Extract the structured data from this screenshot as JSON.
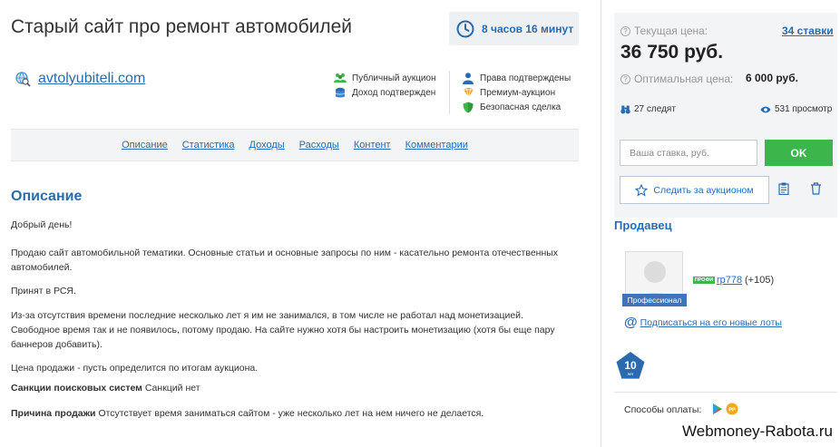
{
  "header": {
    "title": "Старый сайт про ремонт автомобилей",
    "timer": "8 часов 16 минут"
  },
  "site": {
    "link": "avtolyubiteli.com"
  },
  "badges_left": [
    {
      "icon": "users-icon",
      "label": "Публичный аукцион"
    },
    {
      "icon": "coins-icon",
      "label": "Доход подтвержден"
    }
  ],
  "badges_right": [
    {
      "icon": "person-icon",
      "label": "Права подтверждены"
    },
    {
      "icon": "premium-icon",
      "label": "Премиум-аукцион"
    },
    {
      "icon": "shield-icon",
      "label": "Безопасная сделка"
    }
  ],
  "tabs": [
    "Описание",
    "Статистика",
    "Доходы",
    "Расходы",
    "Контент",
    "Комментарии"
  ],
  "description": {
    "title": "Описание",
    "greeting": "Добрый день!",
    "p1": "Продаю сайт автомобильной тематики. Основные статьи и основные запросы по ним - касательно ремонта отечественных автомобилей.",
    "p2": "Принят в РСЯ.",
    "p3": "Из-за отсутствия времени последние несколько лет я им не занимался, в том числе не работал над монетизацией. Свободное время так и не появилось, потому продаю. На сайте нужно хотя бы настроить монетизацию (хотя бы еще пару баннеров добавить).",
    "p4": "Цена продажи - пусть определится по итогам аукциона.",
    "sanctions_label": "Санкции поисковых систем",
    "sanctions_value": "Санкций нет",
    "reason_label": "Причина продажи",
    "reason_value": "Отсутствует время заниматься сайтом - уже несколько лет на нем ничего не делается."
  },
  "auction": {
    "current_price_label": "Текущая цена:",
    "bids_link": "34 ставки",
    "current_price": "36 750 руб.",
    "optimal_label": "Оптимальная цена:",
    "optimal_price": "6 000 руб.",
    "watchers": "27 следят",
    "views": "531 просмотр",
    "bid_placeholder": "Ваша ставка, руб.",
    "ok_label": "OK",
    "follow_label": "Следить за аукционом"
  },
  "seller": {
    "title": "Продавец",
    "pro_tag": "Профессионал",
    "pro_mini": "ПРОФИ",
    "name": "rp778",
    "rating": "(+105)",
    "subscribe_label": "Подписаться на его новые лоты",
    "years": "10",
    "years_unit": "лет"
  },
  "payment": {
    "label": "Способы оплаты:"
  },
  "watermark": "Webmoney-Rabota.ru",
  "colors": {
    "accent": "#2a6bb0",
    "ok_green": "#3cb54a",
    "panel_bg": "#f3f4f6"
  }
}
